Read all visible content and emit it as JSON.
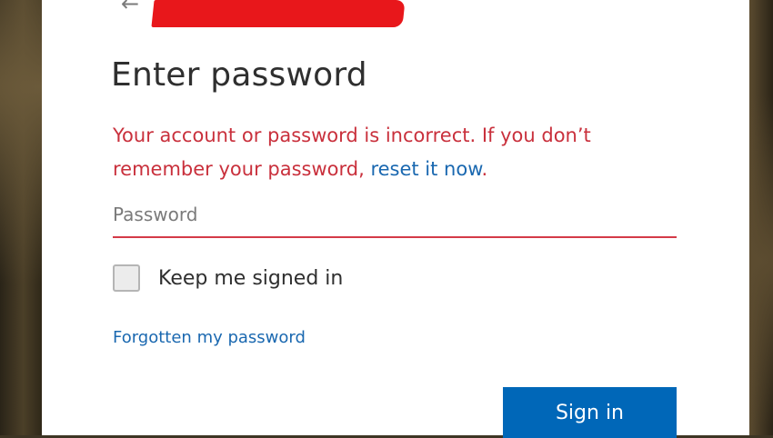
{
  "header": {
    "back_icon": "arrow-left-icon",
    "back_glyph": "←"
  },
  "title": "Enter password",
  "error": {
    "text": "Your account or password is incorrect. If you don’t remember your password, ",
    "link": "reset it now",
    "end": "."
  },
  "password": {
    "placeholder": "Password",
    "value": ""
  },
  "keep_signed_in": {
    "label": "Keep me signed in",
    "checked": false
  },
  "forgot_link": "Forgotten my password",
  "signin_button": "Sign in",
  "colors": {
    "error": "#c9303c",
    "link": "#1a68b0",
    "primary_button": "#0067b8",
    "redaction": "#e8171b"
  }
}
